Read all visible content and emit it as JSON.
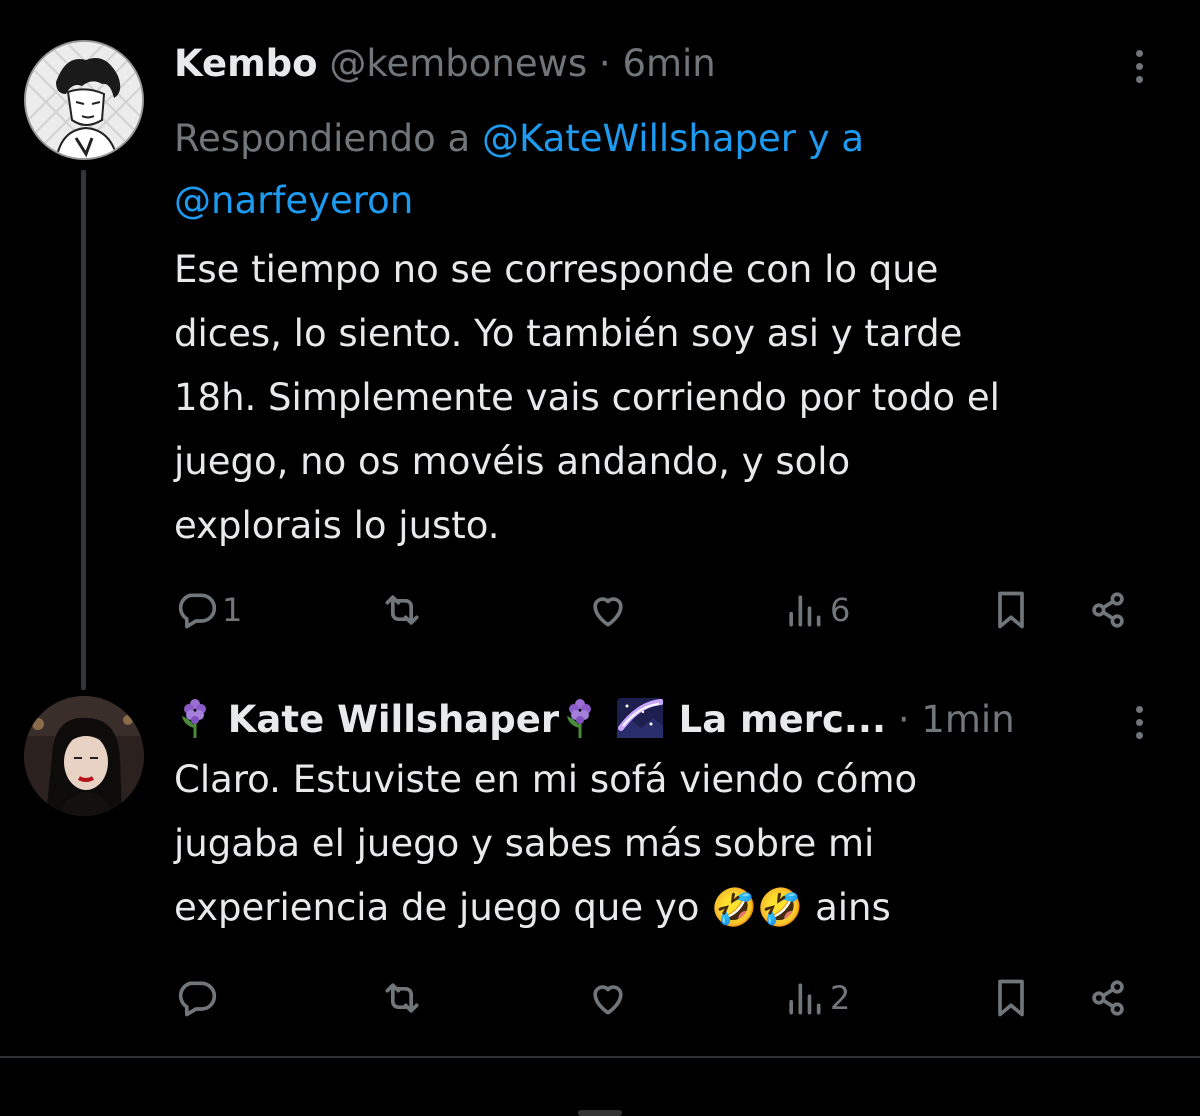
{
  "tweets": [
    {
      "display_name": "Kembo",
      "handle": "@kembonews",
      "separator": "·",
      "time": "6min",
      "replying_prefix": "Respondiendo a",
      "replying_mention1": "@KateWillshaper",
      "replying_joiner": "y a",
      "replying_mention2": "@narfeyeron",
      "text": "Ese tiempo no se corresponde con lo que\ndices, lo siento. Yo también soy asi y tarde\n18h. Simplemente vais corriendo por todo el\njuego, no os movéis andando, y solo\nexplorais lo justo.",
      "actions": {
        "reply_count": "1",
        "retweet_count": "",
        "like_count": "",
        "views_count": "6"
      }
    },
    {
      "display_name": "Kate Willshaper",
      "display_name_suffix": "La merc...",
      "separator": "·",
      "time": "1min",
      "text": "Claro. Estuviste en mi sofá viendo cómo\njugaba el juego y sabes más sobre mi\nexperiencia de juego que yo 🤣🤣 ains",
      "actions": {
        "reply_count": "",
        "retweet_count": "",
        "like_count": "",
        "views_count": "2"
      }
    }
  ],
  "icons": {
    "reply": "reply-icon",
    "retweet": "retweet-icon",
    "like": "heart-icon",
    "views": "views-icon",
    "bookmark": "bookmark-icon",
    "share": "share-icon",
    "more": "more-icon",
    "name_emoji": "hyacinth-icon",
    "galaxy_emoji": "milky-way-icon"
  },
  "colors": {
    "background": "#000000",
    "text": "#e7e9ea",
    "muted": "#71767b",
    "link": "#1d9bf0"
  }
}
